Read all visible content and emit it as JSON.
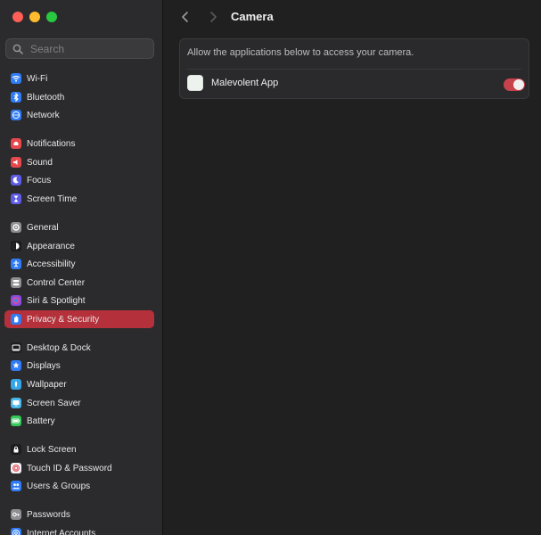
{
  "window": {
    "traffic_lights": [
      "close",
      "minimize",
      "zoom"
    ],
    "colors": {
      "close": "#ff5f57",
      "minimize": "#febc2e",
      "zoom": "#28c840"
    }
  },
  "search": {
    "placeholder": "Search",
    "value": ""
  },
  "sidebar": {
    "items": [
      {
        "label": "Wi-Fi",
        "icon": "wifi-icon",
        "color": "#2f7cf6"
      },
      {
        "label": "Bluetooth",
        "icon": "bluetooth-icon",
        "color": "#2f7cf6"
      },
      {
        "label": "Network",
        "icon": "globe-icon",
        "color": "#2f7cf6"
      },
      {
        "label": "Notifications",
        "icon": "bell-icon",
        "color": "#e5484d"
      },
      {
        "label": "Sound",
        "icon": "speaker-icon",
        "color": "#e5484d"
      },
      {
        "label": "Focus",
        "icon": "moon-icon",
        "color": "#5e5ce6"
      },
      {
        "label": "Screen Time",
        "icon": "hourglass-icon",
        "color": "#5e5ce6"
      },
      {
        "label": "General",
        "icon": "gear-icon",
        "color": "#8e8e93"
      },
      {
        "label": "Appearance",
        "icon": "appearance-icon",
        "color": "#1c1c1e"
      },
      {
        "label": "Accessibility",
        "icon": "accessibility-icon",
        "color": "#2f7cf6"
      },
      {
        "label": "Control Center",
        "icon": "control-center-icon",
        "color": "#8e8e93"
      },
      {
        "label": "Siri & Spotlight",
        "icon": "siri-icon",
        "color": "#8a4be0"
      },
      {
        "label": "Privacy & Security",
        "icon": "hand-icon",
        "color": "#2f7cf6"
      },
      {
        "label": "Desktop & Dock",
        "icon": "dock-icon",
        "color": "#1c1c1e"
      },
      {
        "label": "Displays",
        "icon": "display-icon",
        "color": "#2f7cf6"
      },
      {
        "label": "Wallpaper",
        "icon": "wallpaper-icon",
        "color": "#35a7e8"
      },
      {
        "label": "Screen Saver",
        "icon": "screensaver-icon",
        "color": "#48b7e8"
      },
      {
        "label": "Battery",
        "icon": "battery-icon",
        "color": "#34c759"
      },
      {
        "label": "Lock Screen",
        "icon": "lock-icon",
        "color": "#1c1c1e"
      },
      {
        "label": "Touch ID & Password",
        "icon": "fingerprint-icon",
        "color": "#f2f2f7"
      },
      {
        "label": "Users & Groups",
        "icon": "users-icon",
        "color": "#2f7cf6"
      },
      {
        "label": "Passwords",
        "icon": "key-icon",
        "color": "#8e8e93"
      },
      {
        "label": "Internet Accounts",
        "icon": "at-icon",
        "color": "#2f7cf6"
      }
    ],
    "selected": "Privacy & Security",
    "selected_color": "#b4313b"
  },
  "toolbar": {
    "title": "Camera",
    "back_icon": "chevron-left-icon",
    "forward_icon": "chevron-right-icon"
  },
  "panel": {
    "description": "Allow the applications below to access your camera.",
    "apps": [
      {
        "name": "Malevolent App",
        "enabled": true
      }
    ],
    "toggle_color": "#c8424b"
  }
}
